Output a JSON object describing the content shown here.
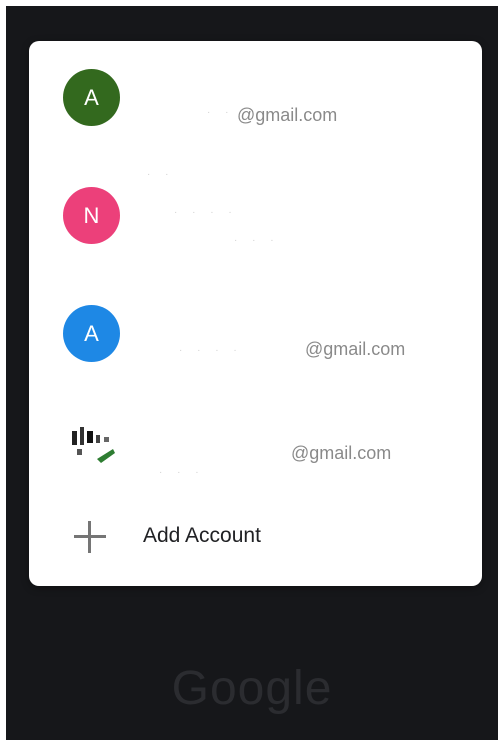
{
  "accounts": [
    {
      "initial": "A",
      "email": "@gmail.com",
      "avatar_color": "#33691e"
    },
    {
      "initial": "N",
      "email": "",
      "avatar_color": "#ec407a"
    },
    {
      "initial": "A",
      "email": "@gmail.com",
      "avatar_color": "#1e88e5"
    },
    {
      "initial": "",
      "email": "@gmail.com",
      "avatar_color": "#ffffff"
    }
  ],
  "add_account_label": "Add Account",
  "brand": "Google",
  "colors": {
    "background": "#16171a",
    "sheet": "#ffffff",
    "primary_text": "#202124",
    "secondary_text": "#8a8a8a"
  }
}
